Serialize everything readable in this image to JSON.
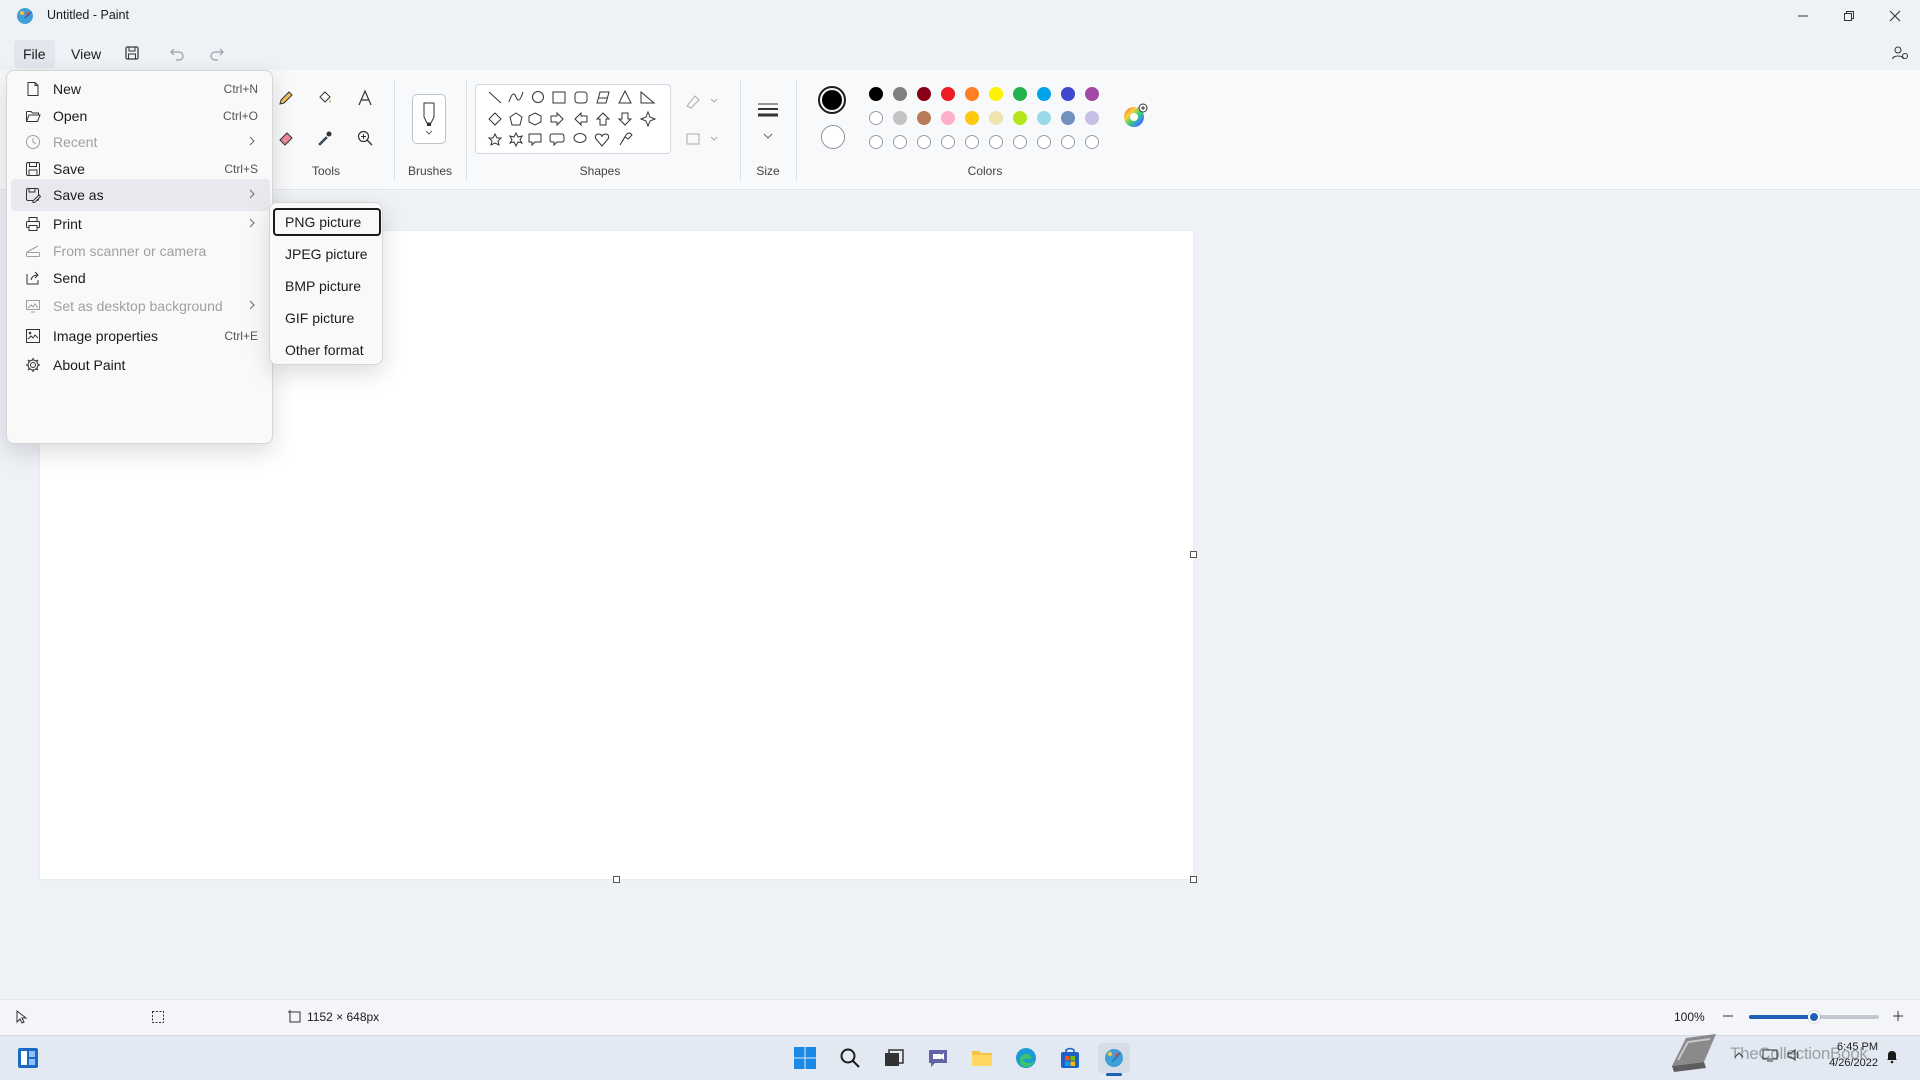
{
  "window": {
    "title": "Untitled - Paint",
    "controls": {
      "minimize": "—",
      "maximize": "▢",
      "close": "✕"
    }
  },
  "menubar": {
    "file": "File",
    "view": "View"
  },
  "ribbon": {
    "groups": {
      "tools": "Tools",
      "brushes": "Brushes",
      "shapes": "Shapes",
      "size": "Size",
      "colors": "Colors"
    },
    "primary_color": "#000000",
    "secondary_color": "#ffffff",
    "palette_row1": [
      "#000000",
      "#7f7f7f",
      "#880015",
      "#ed1c24",
      "#ff7f27",
      "#fff200",
      "#22b14c",
      "#00a2e8",
      "#3f48cc",
      "#a349a4"
    ],
    "palette_row2": [
      "#ffffff",
      "#c3c3c3",
      "#b97a57",
      "#ffaec9",
      "#ffc90e",
      "#efe4b0",
      "#b5e61d",
      "#99d9ea",
      "#7092be",
      "#c8bfe7"
    ],
    "custom_row_count": 10
  },
  "file_menu": {
    "items": [
      {
        "label": "New",
        "shortcut": "Ctrl+N",
        "icon": "new-file-icon",
        "state": "enabled",
        "submenu": false
      },
      {
        "label": "Open",
        "shortcut": "Ctrl+O",
        "icon": "folder-open-icon",
        "state": "enabled",
        "submenu": false
      },
      {
        "label": "Recent",
        "shortcut": "",
        "icon": "clock-icon",
        "state": "disabled",
        "submenu": true
      },
      {
        "label": "Save",
        "shortcut": "Ctrl+S",
        "icon": "save-icon",
        "state": "enabled",
        "submenu": false
      },
      {
        "label": "Save as",
        "shortcut": "",
        "icon": "save-as-icon",
        "state": "active",
        "submenu": true
      },
      {
        "label": "Print",
        "shortcut": "",
        "icon": "printer-icon",
        "state": "enabled",
        "submenu": true
      },
      {
        "label": "From scanner or camera",
        "shortcut": "",
        "icon": "scanner-icon",
        "state": "disabled",
        "submenu": false
      },
      {
        "label": "Send",
        "shortcut": "",
        "icon": "share-icon",
        "state": "enabled",
        "submenu": false
      },
      {
        "label": "Set as desktop background",
        "shortcut": "",
        "icon": "desktop-background-icon",
        "state": "disabled",
        "submenu": true
      },
      {
        "label": "Image properties",
        "shortcut": "Ctrl+E",
        "icon": "image-properties-icon",
        "state": "enabled",
        "submenu": false
      },
      {
        "label": "About Paint",
        "shortcut": "",
        "icon": "gear-icon",
        "state": "enabled",
        "submenu": false
      }
    ]
  },
  "saveas_menu": {
    "items": [
      "PNG picture",
      "JPEG picture",
      "BMP picture",
      "GIF picture",
      "Other format"
    ],
    "focused_index": 0
  },
  "statusbar": {
    "canvas_size": "1152 × 648px",
    "zoom": "100%",
    "zoom_level": 0.5
  },
  "taskbar": {
    "time": "6:45 PM",
    "date": "4/26/2022",
    "watermark": "TheCollectionBook"
  }
}
